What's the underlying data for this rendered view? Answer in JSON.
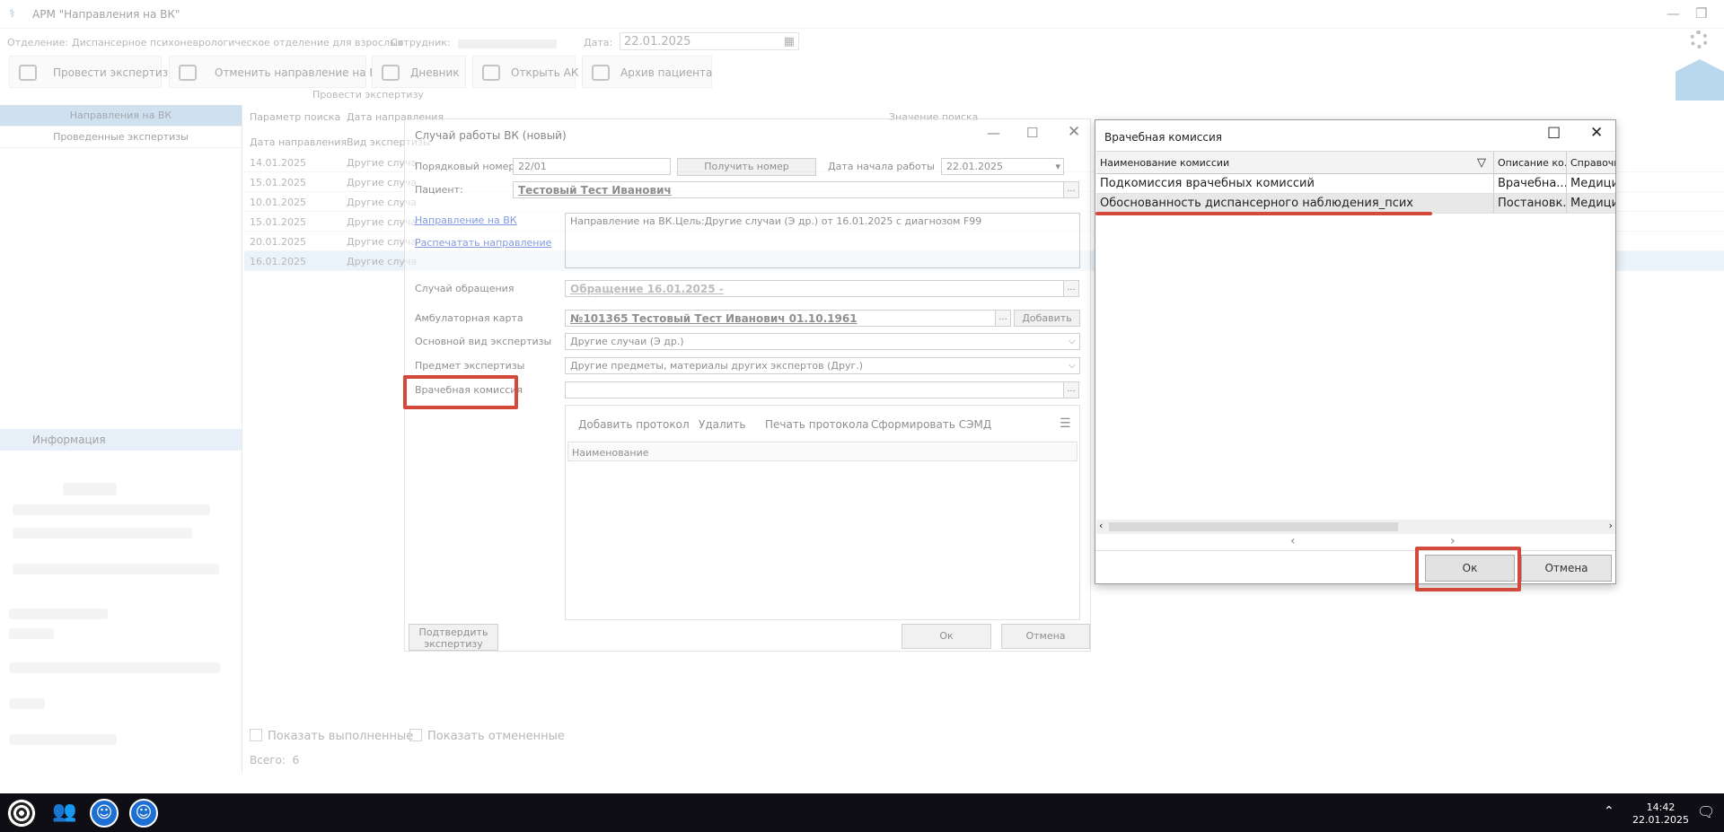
{
  "app": {
    "title": "АРМ \"Направления на ВК\"",
    "department_label": "Отделение:",
    "department_value": "Диспансерное психоневрологическое отделение для взрослых",
    "employee_label": "Сотрудник:",
    "date_label": "Дата:",
    "date_value": "22.01.2025",
    "toolbar": [
      "Провести экспертизу",
      "Отменить направление на ВК",
      "Дневник",
      "Открыть АК",
      "Архив пациента"
    ],
    "toolbar_caption": "Провести экспертизу",
    "left_tabs": [
      "Направления на ВК",
      "Проведенные экспертизы"
    ],
    "info_title": "Информация",
    "search_param_label": "Параметр поиска",
    "search_param_value": "Дата направления",
    "search_value_label": "Значение поиска",
    "grid_headers": [
      "Дата направления",
      "Вид экспертизы"
    ],
    "grid_rows": [
      {
        "date": "14.01.2025",
        "kind": "Другие случа"
      },
      {
        "date": "15.01.2025",
        "kind": "Другие случа"
      },
      {
        "date": "10.01.2025",
        "kind": "Другие случа"
      },
      {
        "date": "15.01.2025",
        "kind": "Другие случа"
      },
      {
        "date": "20.01.2025",
        "kind": "Другие случа"
      },
      {
        "date": "16.01.2025",
        "kind": "Другие случа"
      }
    ],
    "show_done": "Показать выполненные",
    "show_cancelled": "Показать отмененные",
    "total_label": "Всего:",
    "total_value": "6"
  },
  "case_dialog": {
    "title": "Случай работы ВК (новый)",
    "seq_label": "Порядковый номер",
    "seq_value": "22/01",
    "get_number_btn": "Получить номер",
    "start_date_label": "Дата начала работы",
    "start_date_value": "22.01.2025",
    "patient_label": "Пациент:",
    "patient_value": "Тестовый Тест Иванович",
    "link_referral": "Направление на ВК",
    "link_print": "Распечатать направление",
    "referral_text": "Направление на ВК.Цель:Другие случаи (Э др.) от 16.01.2025 с диагнозом F99",
    "visit_label": "Случай обращения",
    "visit_value": "Обращение 16.01.2025 -",
    "card_label": "Амбулаторная карта",
    "card_value": "№101365 Тестовый Тест Иванович 01.10.1961",
    "add_btn": "Добавить",
    "main_kind_label": "Основной вид экспертизы",
    "main_kind_value": "Другие случаи (Э др.)",
    "subject_label": "Предмет экспертизы",
    "subject_value": "Другие предметы, материалы других экспертов (Друг.)",
    "commission_label": "Врачебная комиссия",
    "protocol_tools": [
      "Добавить протокол",
      "Удалить",
      "Печать протокола",
      "Сформировать СЭМД"
    ],
    "protocol_col": "Наименование",
    "confirm_btn": "Подтвердить экспертизу",
    "ok_btn": "Ок",
    "cancel_btn": "Отмена"
  },
  "vk_dialog": {
    "title": "Врачебная комиссия",
    "columns": [
      "Наименование комиссии",
      "Описание ко...",
      "Справочни"
    ],
    "rows": [
      {
        "name": "Подкомиссия врачебных комиссий",
        "desc": "Врачебна...",
        "ref": "Медицин"
      },
      {
        "name": "Обоснованность диспансерного наблюдения_псих",
        "desc": "Постановк...",
        "ref": "Медицин"
      }
    ],
    "ok_btn": "Ок",
    "cancel_btn": "Отмена"
  },
  "taskbar": {
    "time": "14:42",
    "date": "22.01.2025"
  },
  "colors": {
    "highlight": "#d34a3a",
    "selection": "#cfe2f4",
    "accent": "#1b7ca8"
  }
}
